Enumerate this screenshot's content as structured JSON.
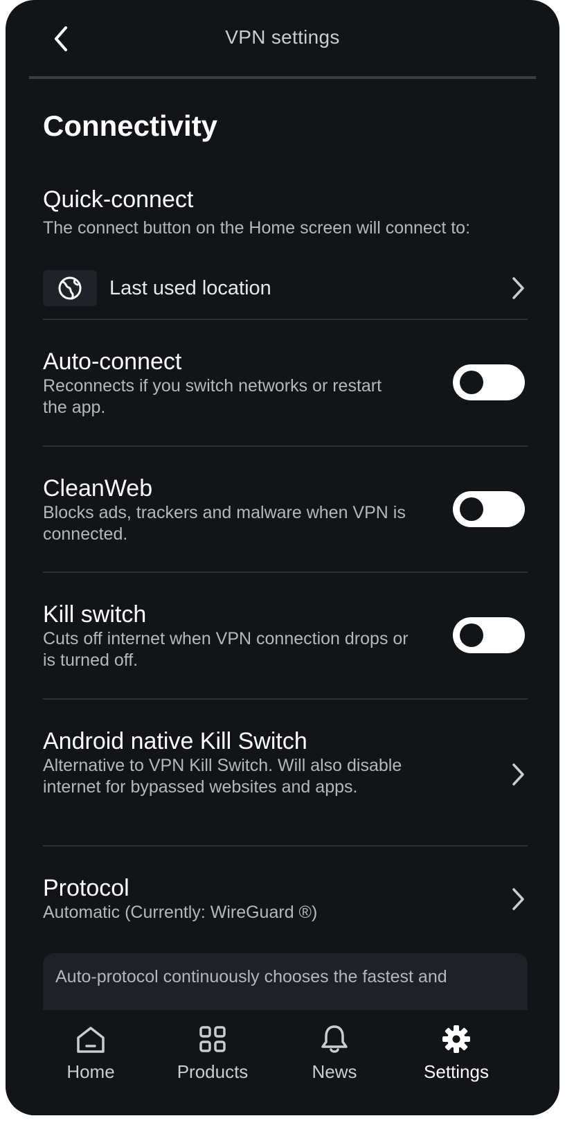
{
  "header": {
    "title": "VPN settings",
    "back_icon": "chevron-left-icon"
  },
  "section": {
    "title": "Connectivity"
  },
  "quick_connect": {
    "title": "Quick-connect",
    "description": "The connect button on the Home screen will connect to:",
    "location_label": "Last used location",
    "location_icon": "globe-icon"
  },
  "settings": [
    {
      "title": "Auto-connect",
      "description": "Reconnects if you switch networks or restart the app.",
      "control": "toggle",
      "enabled": false
    },
    {
      "title": "CleanWeb",
      "description": "Blocks ads, trackers and malware when VPN is connected.",
      "control": "toggle",
      "enabled": false
    },
    {
      "title": "Kill switch",
      "description": "Cuts off internet when VPN connection drops or is turned off.",
      "control": "toggle",
      "enabled": false
    },
    {
      "title": "Android native Kill Switch",
      "description": "Alternative to VPN Kill Switch. Will also disable internet for bypassed websites and apps.",
      "control": "chevron"
    },
    {
      "title": "Protocol",
      "description": "Automatic (Currently: WireGuard ®)",
      "control": "chevron"
    }
  ],
  "info_box": {
    "text": "Auto-protocol continuously chooses the fastest and"
  },
  "bottom_nav": [
    {
      "label": "Home",
      "icon": "home-icon",
      "active": false
    },
    {
      "label": "Products",
      "icon": "grid-icon",
      "active": false
    },
    {
      "label": "News",
      "icon": "bell-icon",
      "active": false
    },
    {
      "label": "Settings",
      "icon": "gear-icon",
      "active": true
    }
  ],
  "colors": {
    "background": "#121417",
    "text_primary": "#ffffff",
    "text_secondary": "#b4b8bd",
    "divider": "#2e3135",
    "toggle_track": "#ffffff"
  }
}
